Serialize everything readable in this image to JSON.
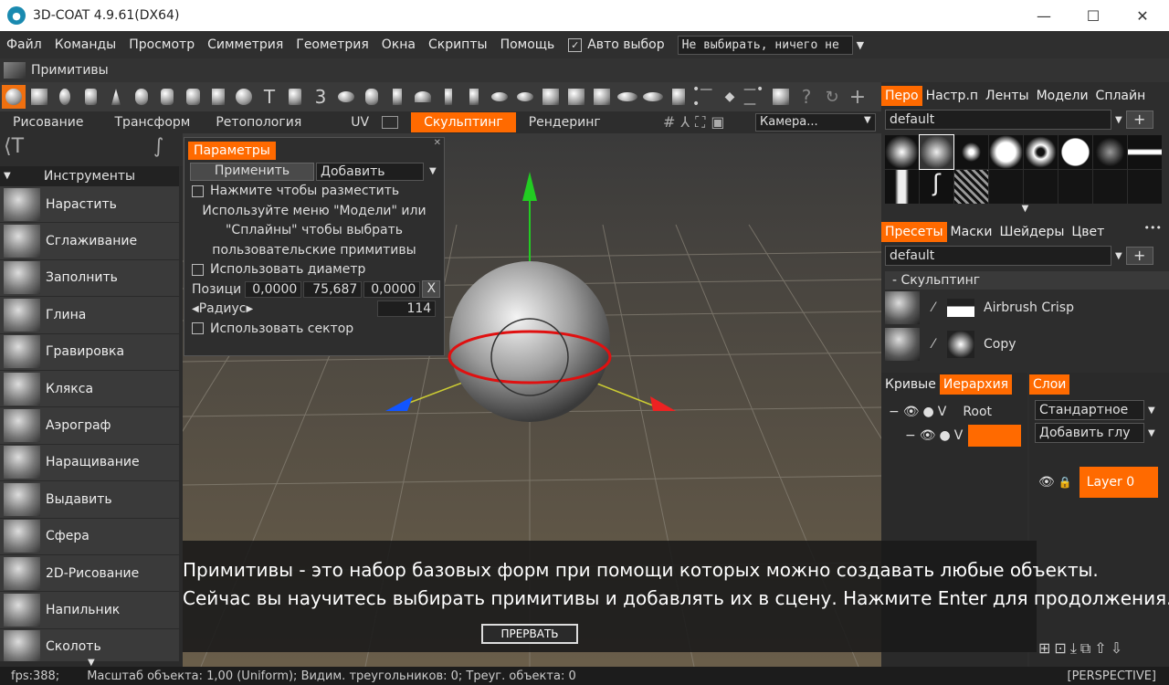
{
  "window": {
    "title": "3D-COAT 4.9.61(DX64)",
    "minimize": "—",
    "maximize": "☐",
    "close": "✕"
  },
  "menu": {
    "items": [
      "Файл",
      "Команды",
      "Просмотр",
      "Симметрия",
      "Геометрия",
      "Окна",
      "Скрипты",
      "Помощь"
    ],
    "auto_select_label": "Авто выбор",
    "auto_select_checked": true,
    "selection_combo": "Не выбирать, ничего не"
  },
  "room": {
    "title": "Примитивы"
  },
  "workspace_tabs": {
    "items": [
      "Рисование",
      "Трансформ",
      "Ретопология",
      "UV",
      "Скульптинг",
      "Рендеринг"
    ],
    "active": "Скульптинг",
    "camera_combo": "Камера..."
  },
  "tools": {
    "header": "Инструменты",
    "items": [
      "Нарастить",
      "Сглаживание",
      "Заполнить",
      "Глина",
      "Гравировка",
      "Клякса",
      "Аэрограф",
      "Наращивание",
      "Выдавить",
      "Сфера",
      "2D-Рисование",
      "Напильник",
      "Сколоть"
    ]
  },
  "params": {
    "tab": "Параметры",
    "apply": "Применить",
    "mode": "Добавить",
    "click_to_place": "Нажмите чтобы разместить",
    "hint1": "Используйте меню \"Модели\" или",
    "hint2": "\"Сплайны\" чтобы выбрать",
    "hint3": "пользовательские примитивы",
    "use_diameter": "Использовать диаметр",
    "position_label": "Позици",
    "pos_x": "0,0000",
    "pos_y": "75,687",
    "pos_z": "0,0000",
    "pos_reset": "X",
    "radius_label": "Радиус",
    "radius_value": "114",
    "use_sector": "Использовать сектор"
  },
  "brush_panel": {
    "tabs": [
      "Перо",
      "Настр.п",
      "Ленты",
      "Модели",
      "Сплайн"
    ],
    "active": "Перо",
    "combo": "default",
    "plus": "+"
  },
  "presets_panel": {
    "tabs": [
      "Пресеты",
      "Маски",
      "Шейдеры",
      "Цвет"
    ],
    "active": "Пресеты",
    "more": "•••",
    "combo": "default",
    "plus": "+",
    "group": "- Скульптинг",
    "items": [
      "Airbrush Crisp",
      "Copy"
    ]
  },
  "hierarchy_panel": {
    "tabs": [
      "Кривые",
      "Иерархия"
    ],
    "active": "Иерархия",
    "root_label": "Root",
    "v_label": "V"
  },
  "layers_panel": {
    "tab": "Слои",
    "blend_combo": "Стандартное",
    "add_combo": "Добавить глу",
    "layer_name": "Layer 0"
  },
  "tutorial": {
    "line1": "Примитивы - это набор базовых форм при помощи которых можно создавать любые объекты.",
    "line2": "Сейчас вы научитесь выбирать примитивы и добавлять их в сцену. Нажмите Enter для продолжения.",
    "abort": "ПРЕРВАТЬ"
  },
  "status": {
    "fps": "fps:388;",
    "text": "Масштаб объекта: 1,00 (Uniform); Видим. треугольников: 0; Треуг. объекта: 0",
    "view": "[PERSPECTIVE]"
  },
  "colors": {
    "accent": "#ff6a00"
  }
}
